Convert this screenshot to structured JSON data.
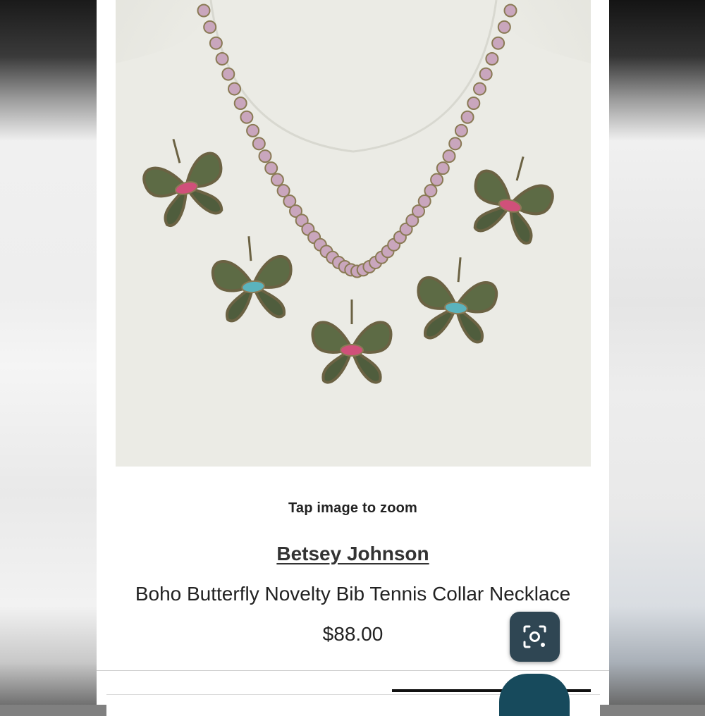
{
  "product": {
    "zoom_hint": "Tap image to zoom",
    "brand": "Betsey Johnson",
    "title": "Boho Butterfly Novelty Bib Tennis Collar Necklace",
    "price": "$88.00"
  },
  "image": {
    "alt": "Boho Butterfly Novelty Bib Tennis Collar Necklace on mannequin bust"
  },
  "icons": {
    "lens": "visual-search-icon"
  },
  "colors": {
    "lens_button": "#2f4653",
    "bottom_button": "#174a5c",
    "crystal": "#c9a6bd",
    "metal": "#6b6243"
  }
}
